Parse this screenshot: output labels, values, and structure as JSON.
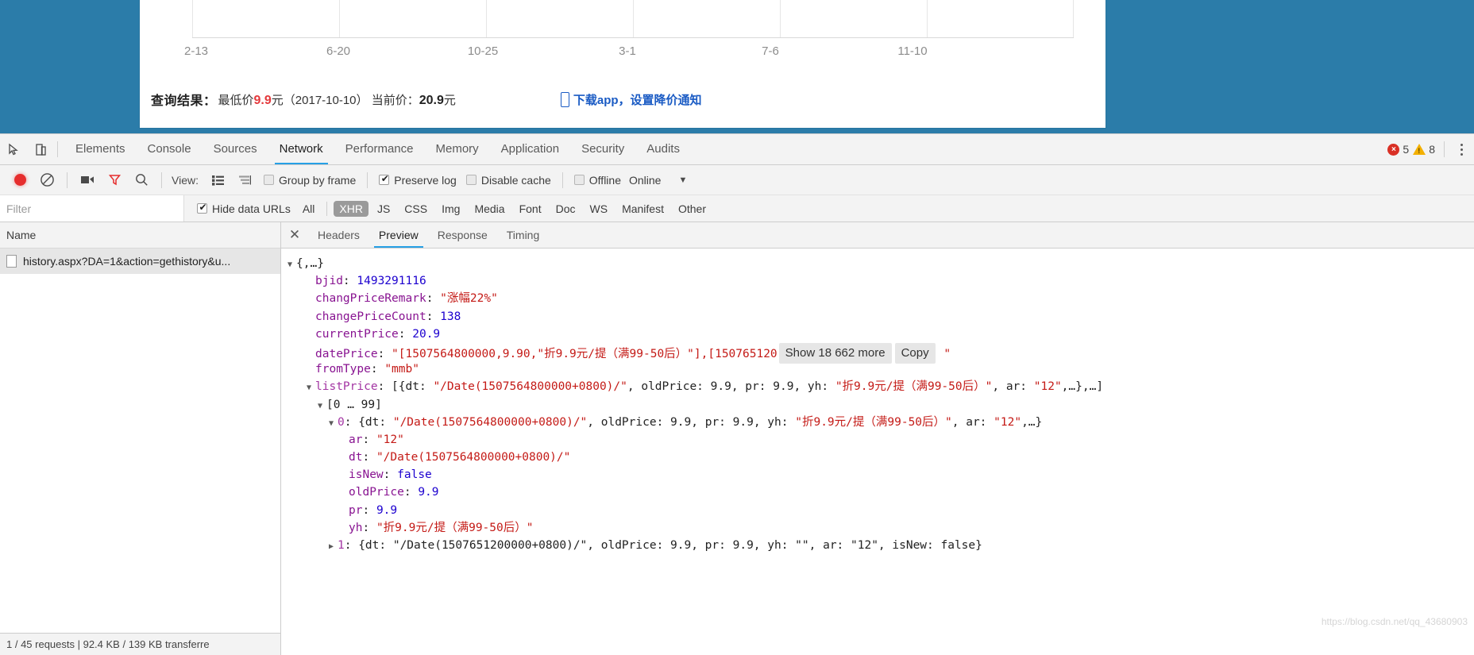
{
  "page": {
    "chart": {
      "x_ticks": [
        "2-13",
        "6-20",
        "10-25",
        "3-1",
        "7-6",
        "11-10"
      ]
    },
    "result": {
      "label": "查询结果：",
      "lowest_prefix": "最低价",
      "lowest_price": "9.9",
      "lowest_unit": "元",
      "lowest_date": "（2017-10-10）",
      "current_prefix": "当前价：",
      "current_price": "20.9",
      "current_unit": "元",
      "app_link": "下载app，设置降价通知"
    }
  },
  "chart_data": {
    "type": "line",
    "title": "",
    "xlabel": "",
    "ylabel": "",
    "x_tick_labels": [
      "2-13",
      "6-20",
      "10-25",
      "3-1",
      "7-6",
      "11-10"
    ],
    "grid": true,
    "annotations": {
      "lowest_price": 9.9,
      "lowest_price_date": "2017-10-10",
      "current_price": 20.9
    }
  },
  "devtools": {
    "tabs": [
      {
        "label": "Elements",
        "active": false
      },
      {
        "label": "Console",
        "active": false
      },
      {
        "label": "Sources",
        "active": false
      },
      {
        "label": "Network",
        "active": true
      },
      {
        "label": "Performance",
        "active": false
      },
      {
        "label": "Memory",
        "active": false
      },
      {
        "label": "Application",
        "active": false
      },
      {
        "label": "Security",
        "active": false
      },
      {
        "label": "Audits",
        "active": false
      }
    ],
    "error_count": "5",
    "warning_count": "8",
    "toolbar": {
      "view_label": "View:",
      "group_by_frame": "Group by frame",
      "preserve_log": "Preserve log",
      "disable_cache": "Disable cache",
      "offline": "Offline",
      "online": "Online",
      "caret": "▼"
    },
    "filter": {
      "placeholder": "Filter",
      "value": "",
      "hide_data_urls": "Hide data URLs",
      "types": [
        "All",
        "XHR",
        "JS",
        "CSS",
        "Img",
        "Media",
        "Font",
        "Doc",
        "WS",
        "Manifest",
        "Other"
      ],
      "active_type": "XHR"
    },
    "left": {
      "column_header": "Name",
      "requests": [
        {
          "name": "history.aspx?DA=1&action=gethistory&u..."
        }
      ],
      "status": "1 / 45 requests | 92.4 KB / 139 KB transferre"
    },
    "detail_tabs": [
      {
        "label": "Headers",
        "active": false
      },
      {
        "label": "Preview",
        "active": true
      },
      {
        "label": "Response",
        "active": false
      },
      {
        "label": "Timing",
        "active": false
      }
    ],
    "preview": {
      "root": "{,…}",
      "show_more_button": "Show 18 662 more",
      "copy_button": "Copy",
      "lines": [
        {
          "indent": 0,
          "arrow": "open",
          "parts": [
            {
              "t": "{,…}",
              "c": "plain"
            }
          ]
        },
        {
          "indent": 1,
          "arrow": "none",
          "parts": [
            {
              "t": "bjid",
              "c": "key"
            },
            {
              "t": ": ",
              "c": "plain"
            },
            {
              "t": "1493291116",
              "c": "num"
            }
          ]
        },
        {
          "indent": 1,
          "arrow": "none",
          "parts": [
            {
              "t": "changPriceRemark",
              "c": "key"
            },
            {
              "t": ": ",
              "c": "plain"
            },
            {
              "t": "\"涨幅22%\"",
              "c": "str"
            }
          ]
        },
        {
          "indent": 1,
          "arrow": "none",
          "parts": [
            {
              "t": "changePriceCount",
              "c": "key"
            },
            {
              "t": ": ",
              "c": "plain"
            },
            {
              "t": "138",
              "c": "num"
            }
          ]
        },
        {
          "indent": 1,
          "arrow": "none",
          "parts": [
            {
              "t": "currentPrice",
              "c": "key"
            },
            {
              "t": ": ",
              "c": "plain"
            },
            {
              "t": "20.9",
              "c": "num"
            }
          ]
        },
        {
          "indent": 1,
          "arrow": "none",
          "buttons": true,
          "parts": [
            {
              "t": "datePrice",
              "c": "key"
            },
            {
              "t": ": ",
              "c": "plain"
            },
            {
              "t": "\"[1507564800000,9.90,\"折9.9元/提（满99-50后）\"],[150765120",
              "c": "str"
            }
          ],
          "tail": [
            {
              "t": " \"",
              "c": "str"
            }
          ]
        },
        {
          "indent": 1,
          "arrow": "none",
          "parts": [
            {
              "t": "fromType",
              "c": "key"
            },
            {
              "t": ": ",
              "c": "plain"
            },
            {
              "t": "\"mmb\"",
              "c": "str"
            }
          ]
        },
        {
          "indent": 1,
          "arrow": "open",
          "parts": [
            {
              "t": "listPrice",
              "c": "key-blue"
            },
            {
              "t": ": [{",
              "c": "plain"
            },
            {
              "t": "dt",
              "c": "plain"
            },
            {
              "t": ": ",
              "c": "plain"
            },
            {
              "t": "\"/Date(1507564800000+0800)/\"",
              "c": "str"
            },
            {
              "t": ", oldPrice: ",
              "c": "plain"
            },
            {
              "t": "9.9",
              "c": "plain"
            },
            {
              "t": ", pr: ",
              "c": "plain"
            },
            {
              "t": "9.9",
              "c": "plain"
            },
            {
              "t": ", yh: ",
              "c": "plain"
            },
            {
              "t": "\"折9.9元/提（满99-50后）\"",
              "c": "str"
            },
            {
              "t": ", ar: ",
              "c": "plain"
            },
            {
              "t": "\"12\"",
              "c": "str"
            },
            {
              "t": ",…},…]",
              "c": "plain"
            }
          ]
        },
        {
          "indent": 2,
          "arrow": "open",
          "parts": [
            {
              "t": "[0 … 99]",
              "c": "plain"
            }
          ]
        },
        {
          "indent": 3,
          "arrow": "open",
          "parts": [
            {
              "t": "0",
              "c": "key-blue"
            },
            {
              "t": ": {dt: ",
              "c": "plain"
            },
            {
              "t": "\"/Date(1507564800000+0800)/\"",
              "c": "str"
            },
            {
              "t": ", oldPrice: ",
              "c": "plain"
            },
            {
              "t": "9.9",
              "c": "plain"
            },
            {
              "t": ", pr: ",
              "c": "plain"
            },
            {
              "t": "9.9",
              "c": "plain"
            },
            {
              "t": ", yh: ",
              "c": "plain"
            },
            {
              "t": "\"折9.9元/提（满99-50后）\"",
              "c": "str"
            },
            {
              "t": ", ar: ",
              "c": "plain"
            },
            {
              "t": "\"12\"",
              "c": "str"
            },
            {
              "t": ",…}",
              "c": "plain"
            }
          ]
        },
        {
          "indent": 4,
          "arrow": "none",
          "parts": [
            {
              "t": "ar",
              "c": "key"
            },
            {
              "t": ": ",
              "c": "plain"
            },
            {
              "t": "\"12\"",
              "c": "str"
            }
          ]
        },
        {
          "indent": 4,
          "arrow": "none",
          "parts": [
            {
              "t": "dt",
              "c": "key"
            },
            {
              "t": ": ",
              "c": "plain"
            },
            {
              "t": "\"/Date(1507564800000+0800)/\"",
              "c": "str"
            }
          ]
        },
        {
          "indent": 4,
          "arrow": "none",
          "parts": [
            {
              "t": "isNew",
              "c": "key"
            },
            {
              "t": ": ",
              "c": "plain"
            },
            {
              "t": "false",
              "c": "bool"
            }
          ]
        },
        {
          "indent": 4,
          "arrow": "none",
          "parts": [
            {
              "t": "oldPrice",
              "c": "key"
            },
            {
              "t": ": ",
              "c": "plain"
            },
            {
              "t": "9.9",
              "c": "num"
            }
          ]
        },
        {
          "indent": 4,
          "arrow": "none",
          "parts": [
            {
              "t": "pr",
              "c": "key"
            },
            {
              "t": ": ",
              "c": "plain"
            },
            {
              "t": "9.9",
              "c": "num"
            }
          ]
        },
        {
          "indent": 4,
          "arrow": "none",
          "parts": [
            {
              "t": "yh",
              "c": "key"
            },
            {
              "t": ": ",
              "c": "plain"
            },
            {
              "t": "\"折9.9元/提（满99-50后）\"",
              "c": "str"
            }
          ]
        },
        {
          "indent": 3,
          "arrow": "closed",
          "parts": [
            {
              "t": "1",
              "c": "key-blue"
            },
            {
              "t": ": {dt: ",
              "c": "plain"
            },
            {
              "t": "\"/Date(1507651200000+0800)/\"",
              "c": "plain"
            },
            {
              "t": ", oldPrice: 9.9, pr: 9.9, yh: \"\", ar: \"12\", isNew: false}",
              "c": "plain"
            }
          ]
        }
      ]
    },
    "watermark": "https://blog.csdn.net/qq_43680903"
  }
}
